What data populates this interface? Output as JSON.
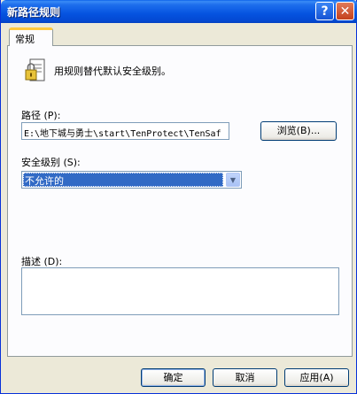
{
  "window": {
    "title": "新路径规则",
    "help_label": "?",
    "close_label": "✕"
  },
  "tabs": [
    {
      "label": "常规"
    }
  ],
  "general": {
    "policy_text": "用规则替代默认安全级别。",
    "path_label": "路径 (P):",
    "path_value": "E:\\地下城与勇士\\start\\TenProtect\\TenSaf",
    "browse_label": "浏览(B)...",
    "security_level_label": "安全级别 (S):",
    "security_level_value": "不允许的",
    "description_label": "描述 (D):",
    "description_value": ""
  },
  "footer": {
    "ok_label": "确定",
    "cancel_label": "取消",
    "apply_label": "应用(A)"
  },
  "icons": {
    "help": "help-icon",
    "close": "close-icon",
    "policy": "policy-document-lock-icon",
    "dropdown": "chevron-down-icon"
  }
}
